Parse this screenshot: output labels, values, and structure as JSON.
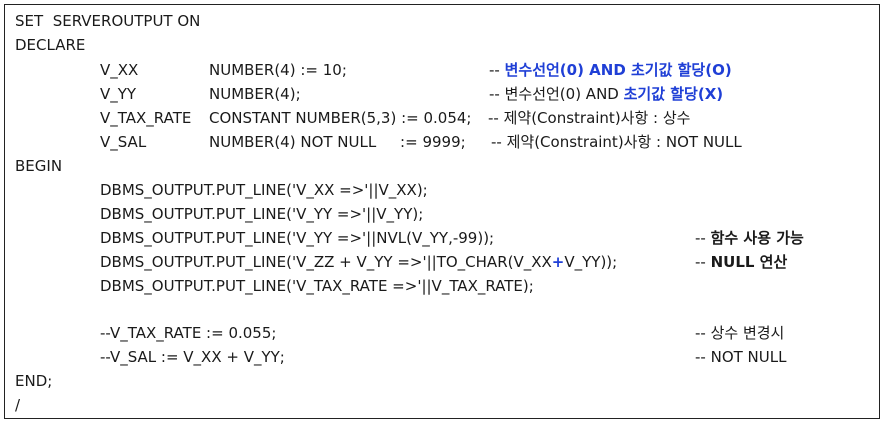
{
  "code": {
    "set_line": "SET  SERVEROUTPUT ON",
    "declare": "DECLARE",
    "vars": [
      {
        "name": "V_XX",
        "decl": "NUMBER(4) := 10;",
        "comment_prefix": "-- ",
        "comment_a": "변수선언(0) AND 초기값 할당(O)",
        "comment_b": ""
      },
      {
        "name": "V_YY",
        "decl": "NUMBER(4);",
        "comment_prefix": "-- ",
        "comment_a": "변수선언(0) AND ",
        "comment_b": "초기값 할당(X)"
      },
      {
        "name": "V_TAX_RATE",
        "decl": "CONSTANT NUMBER(5,3) := 0.054;",
        "comment_prefix": "-- ",
        "comment_a": "제약(Constraint)사항 : 상수",
        "comment_b": ""
      },
      {
        "name": "V_SAL",
        "decl": "NUMBER(4) NOT NULL     := 9999;",
        "comment_prefix": "-- ",
        "comment_a": "제약(Constraint)사항 : NOT NULL",
        "comment_b": ""
      }
    ],
    "begin": "BEGIN",
    "stmts": [
      {
        "text": "DBMS_OUTPUT.PUT_LINE('V_XX =>'||V_XX);",
        "comment_prefix": "",
        "comment": ""
      },
      {
        "text": "DBMS_OUTPUT.PUT_LINE('V_YY =>'||V_YY);",
        "comment_prefix": "",
        "comment": ""
      },
      {
        "text": "DBMS_OUTPUT.PUT_LINE('V_YY =>'||NVL(V_YY,-99));",
        "comment_prefix": "-- ",
        "comment": "함수 사용 가능"
      },
      {
        "text_a": "DBMS_OUTPUT.PUT_LINE('V_ZZ + V_YY =>'||TO_CHAR(V_XX",
        "text_op": "+",
        "text_b": "V_YY));",
        "comment_prefix": "-- ",
        "comment": "NULL 연산"
      },
      {
        "text": "DBMS_OUTPUT.PUT_LINE('V_TAX_RATE =>'||V_TAX_RATE);",
        "comment_prefix": "",
        "comment": ""
      }
    ],
    "commented": [
      {
        "text": "--V_TAX_RATE := 0.055;",
        "comment": "-- 상수 변경시"
      },
      {
        "text": "--V_SAL := V_XX + V_YY;",
        "comment": "-- NOT NULL"
      }
    ],
    "end": "END;",
    "slash": "/"
  }
}
